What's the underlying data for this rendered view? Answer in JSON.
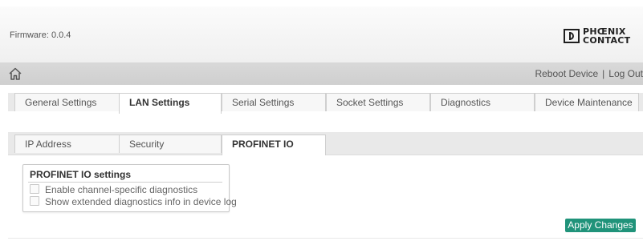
{
  "header": {
    "firmware_label": "Firmware: 0.0.4",
    "logo_line1": "PHŒNIX",
    "logo_line2": "CONTACT"
  },
  "nav": {
    "home_icon": "home-icon",
    "reboot_label": "Reboot Device",
    "separator": "|",
    "logout_label": "Log Out"
  },
  "tabs": [
    {
      "label": "General Settings",
      "active": false
    },
    {
      "label": "LAN Settings",
      "active": true
    },
    {
      "label": "Serial Settings",
      "active": false
    },
    {
      "label": "Socket Settings",
      "active": false
    },
    {
      "label": "Diagnostics",
      "active": false
    },
    {
      "label": "Device Maintenance",
      "active": false
    }
  ],
  "subtabs": [
    {
      "label": "IP Address",
      "active": false
    },
    {
      "label": "Security",
      "active": false
    },
    {
      "label": "PROFINET IO",
      "active": true
    }
  ],
  "profinet": {
    "title": "PROFINET IO settings",
    "options": [
      {
        "label": "Enable channel-specific diagnostics",
        "checked": false
      },
      {
        "label": "Show extended diagnostics info in device log",
        "checked": false
      }
    ]
  },
  "actions": {
    "apply_label": "Apply Changes"
  },
  "colors": {
    "accent": "#20937a",
    "header_bg": "#f4f4f4",
    "nav_bg": "#d5d5d5"
  }
}
